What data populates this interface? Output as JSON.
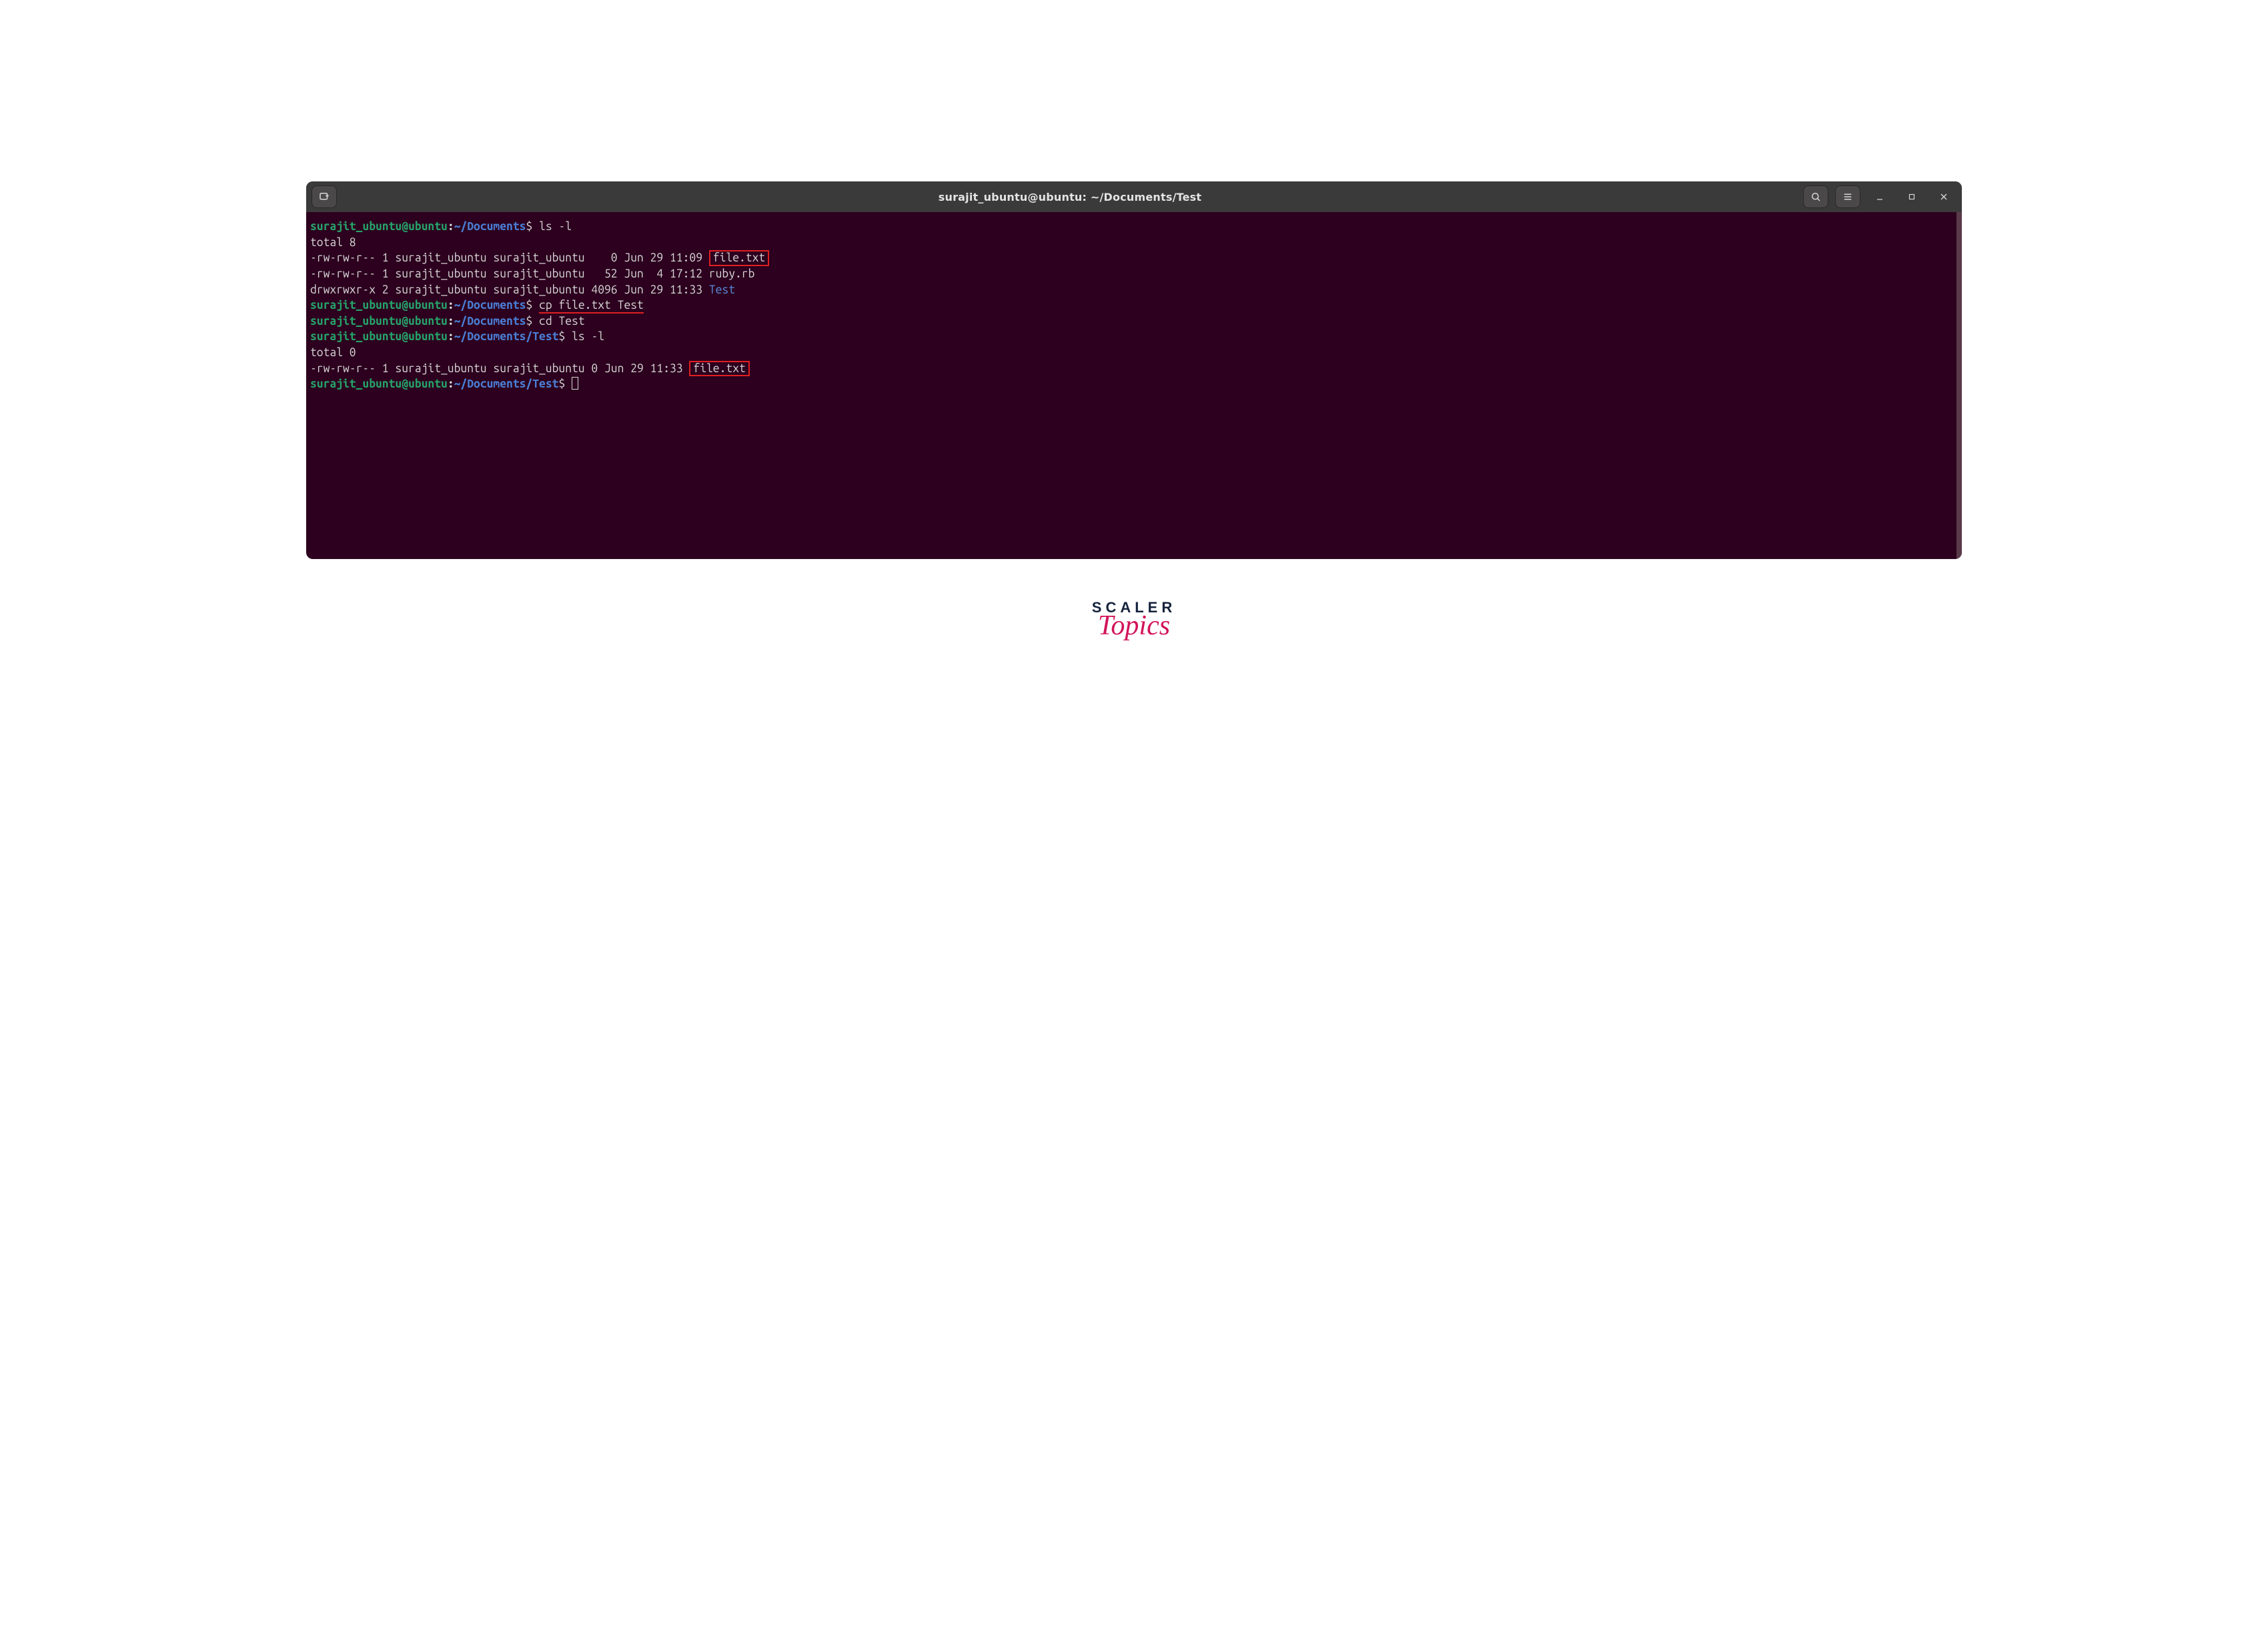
{
  "titlebar": {
    "title": "surajit_ubuntu@ubuntu: ~/Documents/Test"
  },
  "prompts": {
    "user": "surajit_ubuntu@ubuntu",
    "colon": ":",
    "cwd_docs": "~/Documents",
    "cwd_test": "~/Documents/Test",
    "dollar": "$"
  },
  "lines": {
    "cmd1": " ls -l",
    "total1": "total 8",
    "row1a": "-rw-rw-r-- 1 surajit_ubuntu surajit_ubuntu    0 Jun 29 11:09 ",
    "row1a_file": "file.txt",
    "row1b": "-rw-rw-r-- 1 surajit_ubuntu surajit_ubuntu   52 Jun  4 17:12 ruby.rb",
    "row1c_pre": "drwxrwxr-x 2 surajit_ubuntu surajit_ubuntu 4096 Jun 29 11:33 ",
    "row1c_dir": "Test",
    "cmd2_pre": " ",
    "cmd2_underlined": "cp file.txt Test",
    "cmd3": " cd Test",
    "cmd4": " ls -l",
    "total2": "total 0",
    "row2a": "-rw-rw-r-- 1 surajit_ubuntu surajit_ubuntu 0 Jun 29 11:33 ",
    "row2a_file": "file.txt",
    "cmd5": " "
  },
  "branding": {
    "scaler": "SCALER",
    "topics": "Topics"
  }
}
